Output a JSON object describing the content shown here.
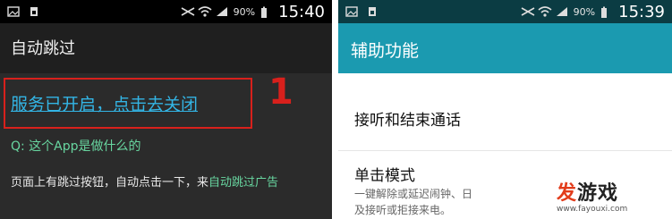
{
  "left": {
    "status": {
      "battery": "90%",
      "time": "15:40"
    },
    "title": "自动跳过",
    "service_link": "服务已开启，点击去关闭",
    "annotation_number": "1",
    "question": "Q: 这个App是做什么的",
    "description_prefix": "页面上有跳过按钮，自动点击一下，来",
    "description_highlight": "自动跳过广告"
  },
  "right": {
    "status": {
      "battery": "90%",
      "time": "15:39"
    },
    "title": "辅助功能",
    "item1": "接听和结束通话",
    "item2": "单击模式",
    "item2_sub_line1": "一键解除或延迟闹钟、日",
    "item2_sub_line2": "及接听或拒接来电。"
  },
  "watermark": {
    "brand_first": "发",
    "brand_rest": "游戏",
    "url": "www.fayouxi.com"
  },
  "colors": {
    "accent_red": "#d8201c",
    "link_blue": "#33b5e5",
    "green_text": "#68d6a0",
    "teal_actionbar": "#1b9ab0"
  }
}
